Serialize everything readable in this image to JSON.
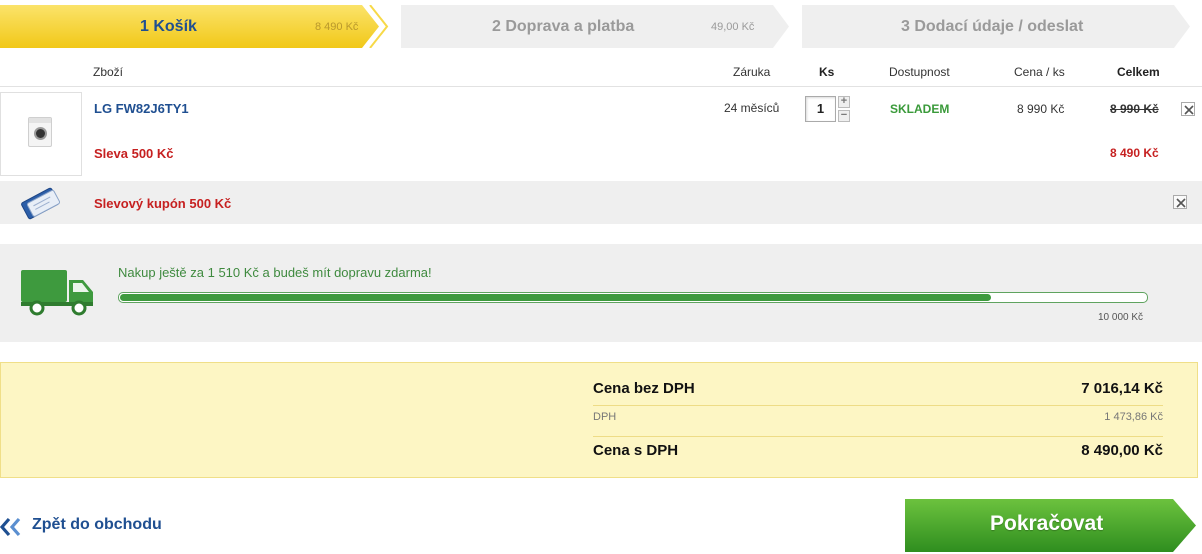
{
  "steps": [
    {
      "label": "1 Košík",
      "price": "8 490 Kč",
      "state": "active"
    },
    {
      "label": "2 Doprava a platba",
      "price": "49,00 Kč",
      "state": "inactive"
    },
    {
      "label": "3 Dodací údaje / odeslat",
      "price": "",
      "state": "inactive"
    }
  ],
  "table_header": {
    "product": "Zboží",
    "warranty": "Záruka",
    "quantity": "Ks",
    "availability": "Dostupnost",
    "unit_price": "Cena / ks",
    "total": "Celkem"
  },
  "item": {
    "name": "LG FW82J6TY1",
    "warranty": "24 měsíců",
    "quantity": "1",
    "availability": "SKLADEM",
    "unit_price": "8 990 Kč",
    "total_original": "8 990 Kč",
    "discount_label": "Sleva 500 Kč",
    "total_after_discount": "8 490 Kč",
    "image_icon": "washing-machine-icon"
  },
  "coupon": {
    "label": "Slevový kupón 500 Kč",
    "icon": "coupon-icon"
  },
  "free_shipping": {
    "message": "Nakup ještě za 1 510 Kč a budeš mít dopravu zdarma!",
    "progress_fraction": 0.849,
    "target_label": "10 000 Kč",
    "icon": "truck-icon"
  },
  "summary": {
    "without_vat_label": "Cena bez DPH",
    "without_vat_value": "7 016,14 Kč",
    "vat_label": "DPH",
    "vat_value": "1 473,86 Kč",
    "with_vat_label": "Cena s DPH",
    "with_vat_value": "8 490,00 Kč"
  },
  "footer": {
    "back_label": "Zpět do obchodu",
    "continue_label": "Pokračovat"
  },
  "colors": {
    "brand_blue": "#1f4f91",
    "active_step_yellow": "#f5d431",
    "success_green": "#3e9a3e",
    "discount_red": "#c62020",
    "summary_bg": "#fdf6c4"
  }
}
